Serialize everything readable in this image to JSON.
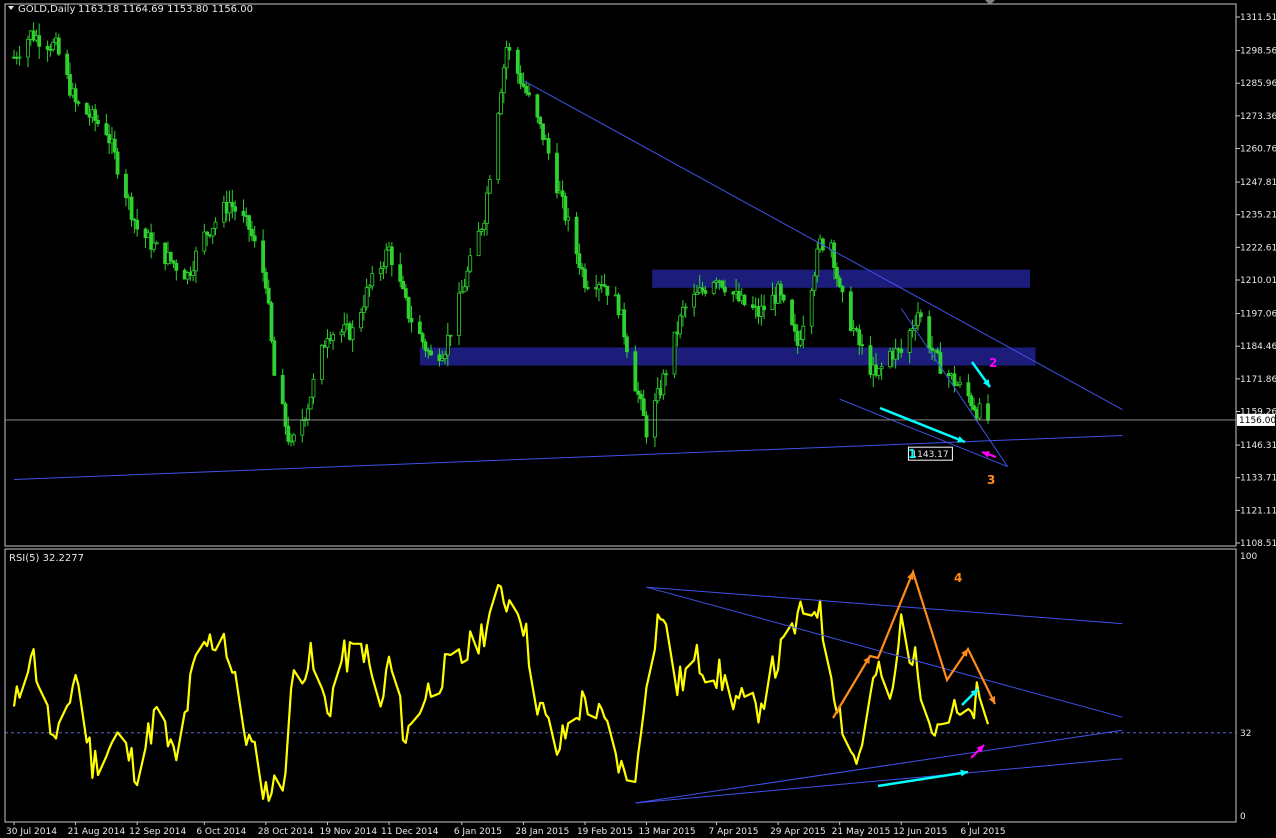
{
  "price_panel": {
    "symbol_label": "GOLD,Daily",
    "ohlc_label": "1163.18 1164.69 1153.80 1156.00",
    "current_price_label": "1156.00",
    "low_marker_label": "1143.17"
  },
  "rsi_panel": {
    "label": "RSI(5) 32.2277",
    "level_label": "32"
  },
  "annotations": [
    "1",
    "2",
    "3",
    "4"
  ],
  "colors": {
    "background": "#000000",
    "candles": "#2fd12f",
    "rsi_line": "#ffff00",
    "trendlines": "#3f52e8",
    "zones": "#1c1c7a",
    "cyan_arrows": "#00ffff",
    "magenta_arrows": "#ff00ff",
    "orange_path": "#ff8c1a"
  },
  "chart_data": [
    {
      "type": "candlestick",
      "title": "GOLD,Daily",
      "y_ticks": [
        "1311.51",
        "1298.56",
        "1285.96",
        "1273.36",
        "1260.76",
        "1247.81",
        "1235.21",
        "1222.61",
        "1210.01",
        "1197.06",
        "1184.46",
        "1171.86",
        "1159.26",
        "1146.31",
        "1133.71",
        "1121.11",
        "1108.51"
      ],
      "ylim": [
        1105,
        1314
      ],
      "x_ticks": [
        "30 Jul 2014",
        "21 Aug 2014",
        "12 Sep 2014",
        "6 Oct 2014",
        "28 Oct 2014",
        "19 Nov 2014",
        "11 Dec 2014",
        "6 Jan 2015",
        "28 Jan 2015",
        "19 Feb 2015",
        "13 Mar 2015",
        "7 Apr 2015",
        "29 Apr 2015",
        "21 May 2015",
        "12 Jun 2015",
        "6 Jul 2015"
      ],
      "close_path": [
        [
          "30 Jul 2014",
          1296
        ],
        [
          "5 Aug 2014",
          1305
        ],
        [
          "14 Aug 2014",
          1300
        ],
        [
          "21 Aug 2014",
          1278
        ],
        [
          "1 Sep 2014",
          1268
        ],
        [
          "12 Sep 2014",
          1230
        ],
        [
          "19 Sep 2014",
          1222
        ],
        [
          "30 Sep 2014",
          1212
        ],
        [
          "6 Oct 2014",
          1227
        ],
        [
          "15 Oct 2014",
          1240
        ],
        [
          "22 Oct 2014",
          1230
        ],
        [
          "28 Oct 2014",
          1210
        ],
        [
          "31 Oct 2014",
          1173
        ],
        [
          "6 Nov 2014",
          1145
        ],
        [
          "12 Nov 2014",
          1162
        ],
        [
          "19 Nov 2014",
          1190
        ],
        [
          "28 Nov 2014",
          1190
        ],
        [
          "3 Dec 2014",
          1205
        ],
        [
          "11 Dec 2014",
          1222
        ],
        [
          "18 Dec 2014",
          1197
        ],
        [
          "26 Dec 2014",
          1180
        ],
        [
          "31 Dec 2014",
          1184
        ],
        [
          "6 Jan 2015",
          1205
        ],
        [
          "14 Jan 2015",
          1235
        ],
        [
          "20 Jan 2015",
          1285
        ],
        [
          "22 Jan 2015",
          1300
        ],
        [
          "28 Jan 2015",
          1285
        ],
        [
          "5 Feb 2015",
          1263
        ],
        [
          "12 Feb 2015",
          1235
        ],
        [
          "19 Feb 2015",
          1210
        ],
        [
          "25 Feb 2015",
          1210
        ],
        [
          "3 Mar 2015",
          1200
        ],
        [
          "9 Mar 2015",
          1170
        ],
        [
          "13 Mar 2015",
          1152
        ],
        [
          "18 Mar 2015",
          1168
        ],
        [
          "26 Mar 2015",
          1198
        ],
        [
          "7 Apr 2015",
          1212
        ],
        [
          "15 Apr 2015",
          1202
        ],
        [
          "22 Apr 2015",
          1197
        ],
        [
          "29 Apr 2015",
          1205
        ],
        [
          "6 May 2015",
          1185
        ],
        [
          "14 May 2015",
          1224
        ],
        [
          "18 May 2015",
          1225
        ],
        [
          "21 May 2015",
          1205
        ],
        [
          "28 May 2015",
          1185
        ],
        [
          "3 Jun 2015",
          1172
        ],
        [
          "8 Jun 2015",
          1182
        ],
        [
          "12 Jun 2015",
          1182
        ],
        [
          "18 Jun 2015",
          1198
        ],
        [
          "24 Jun 2015",
          1180
        ],
        [
          "30 Jun 2015",
          1172
        ],
        [
          "6 Jul 2015",
          1165
        ],
        [
          "9 Jul 2015",
          1160
        ],
        [
          "13 Jul 2015",
          1156
        ]
      ],
      "zones": [
        {
          "from": "15 Mar 2015",
          "to": "28 Jul 2015",
          "low": 1207,
          "high": 1214
        },
        {
          "from": "22 Dec 2014",
          "to": "30 Jul 2015",
          "low": 1177,
          "high": 1184
        }
      ],
      "horizontal_line": 1156.0,
      "trendlines": [
        {
          "from": [
            "30 Jul 2014",
            1133
          ],
          "to": [
            "30 Aug 2015",
            1150
          ]
        },
        {
          "from": [
            "28 Jan 2015",
            1287
          ],
          "to": [
            "30 Aug 2015",
            1160
          ]
        },
        {
          "from": [
            "12 Jun 2015",
            1199
          ],
          "to": [
            "20 Jul 2015",
            1138
          ]
        },
        {
          "from": [
            "21 May 2015",
            1164
          ],
          "to": [
            "20 Jul 2015",
            1138
          ]
        }
      ]
    },
    {
      "type": "line",
      "title": "RSI(5) 32.2277",
      "ylim": [
        0,
        100
      ],
      "y_ticks": [
        "100",
        "32",
        "0"
      ],
      "reference_line": 32,
      "series": [
        {
          "values": [
            [
              "30 Jul 2014",
              40
            ],
            [
              "5 Aug 2014",
              65
            ],
            [
              "14 Aug 2014",
              25
            ],
            [
              "21 Aug 2014",
              55
            ],
            [
              "27 Aug 2014",
              20
            ],
            [
              "5 Sep 2014",
              30
            ],
            [
              "12 Sep 2014",
              18
            ],
            [
              "19 Sep 2014",
              40
            ],
            [
              "26 Sep 2014",
              20
            ],
            [
              "2 Oct 2014",
              55
            ],
            [
              "6 Oct 2014",
              65
            ],
            [
              "13 Oct 2014",
              70
            ],
            [
              "20 Oct 2014",
              35
            ],
            [
              "28 Oct 2014",
              10
            ],
            [
              "3 Nov 2014",
              12
            ],
            [
              "7 Nov 2014",
              55
            ],
            [
              "13 Nov 2014",
              60
            ],
            [
              "19 Nov 2014",
              40
            ],
            [
              "24 Nov 2014",
              60
            ],
            [
              "2 Dec 2014",
              65
            ],
            [
              "8 Dec 2014",
              40
            ],
            [
              "11 Dec 2014",
              60
            ],
            [
              "17 Dec 2014",
              30
            ],
            [
              "23 Dec 2014",
              45
            ],
            [
              "30 Dec 2014",
              55
            ],
            [
              "6 Jan 2015",
              60
            ],
            [
              "13 Jan 2015",
              70
            ],
            [
              "20 Jan 2015",
              85
            ],
            [
              "27 Jan 2015",
              80
            ],
            [
              "2 Feb 2015",
              45
            ],
            [
              "9 Feb 2015",
              25
            ],
            [
              "16 Feb 2015",
              40
            ],
            [
              "19 Feb 2015",
              45
            ],
            [
              "26 Feb 2015",
              35
            ],
            [
              "5 Mar 2015",
              15
            ],
            [
              "10 Mar 2015",
              20
            ],
            [
              "13 Mar 2015",
              55
            ],
            [
              "18 Mar 2015",
              80
            ],
            [
              "24 Mar 2015",
              50
            ],
            [
              "31 Mar 2015",
              60
            ],
            [
              "7 Apr 2015",
              55
            ],
            [
              "14 Apr 2015",
              45
            ],
            [
              "21 Apr 2015",
              40
            ],
            [
              "29 Apr 2015",
              60
            ],
            [
              "6 May 2015",
              75
            ],
            [
              "13 May 2015",
              82
            ],
            [
              "21 May 2015",
              40
            ],
            [
              "27 May 2015",
              20
            ],
            [
              "3 Jun 2015",
              55
            ],
            [
              "9 Jun 2015",
              45
            ],
            [
              "12 Jun 2015",
              75
            ],
            [
              "18 Jun 2015",
              55
            ],
            [
              "24 Jun 2015",
              35
            ],
            [
              "30 Jun 2015",
              40
            ],
            [
              "6 Jul 2015",
              35
            ],
            [
              "9 Jul 2015",
              45
            ],
            [
              "13 Jul 2015",
              32
            ]
          ]
        }
      ]
    }
  ]
}
